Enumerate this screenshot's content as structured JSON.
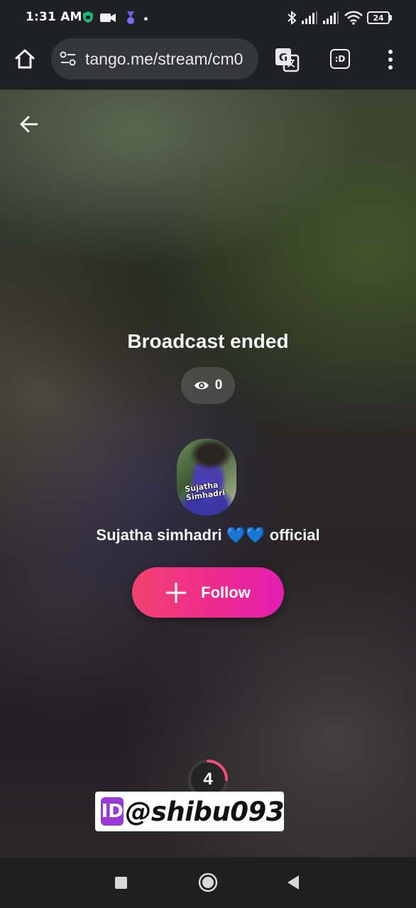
{
  "status_bar": {
    "time": "1:31 AM",
    "battery": "24",
    "icons": [
      "lock-shield-icon",
      "video-camera-icon",
      "app-notification-icon",
      "dot-icon",
      "bluetooth-icon",
      "signal-icon",
      "signal-icon",
      "wifi-icon",
      "battery-icon"
    ]
  },
  "browser": {
    "url": "tango.me/stream/cm0",
    "home_icon": "home-icon",
    "site_settings_icon": "tune-icon",
    "translate_icon": "translate-icon",
    "tabs_label": ":D",
    "menu_icon": "more-vert-icon"
  },
  "stream": {
    "title": "Broadcast ended",
    "viewer_count": "0",
    "avatar_caption_line1": "Sujatha",
    "avatar_caption_line2": "Simhadri",
    "username_prefix": "Sujatha simhadri ",
    "username_hearts": "💙💙",
    "username_suffix": " official",
    "follow_label": "Follow",
    "countdown": "4",
    "countdown_progress": 0.25
  },
  "overlay": {
    "id_badge": "ID",
    "handle": "@shibu093"
  },
  "colors": {
    "follow_start": "#f2436f",
    "follow_end": "#e21fb1",
    "countdown_ring": "#f04e6e"
  }
}
